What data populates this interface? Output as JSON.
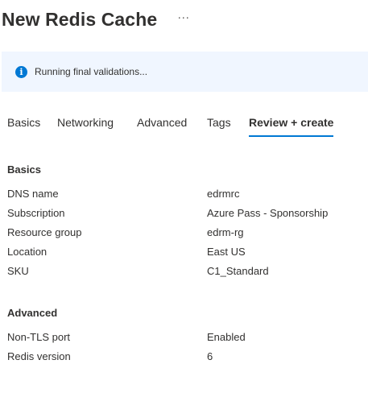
{
  "header": {
    "title": "New Redis Cache",
    "more_label": "···"
  },
  "notice": {
    "icon": "info-icon",
    "icon_glyph": "i",
    "text": "Running final validations..."
  },
  "tabs": [
    {
      "label": "Basics",
      "active": false
    },
    {
      "label": "Networking",
      "active": false
    },
    {
      "label": "Advanced",
      "active": false
    },
    {
      "label": "Tags",
      "active": false
    },
    {
      "label": "Review + create",
      "active": true
    }
  ],
  "sections": {
    "basics": {
      "title": "Basics",
      "rows": [
        {
          "label": "DNS name",
          "value": "edrmrc"
        },
        {
          "label": "Subscription",
          "value": "Azure Pass - Sponsorship"
        },
        {
          "label": "Resource group",
          "value": "edrm-rg"
        },
        {
          "label": "Location",
          "value": "East US"
        },
        {
          "label": "SKU",
          "value": "C1_Standard"
        }
      ]
    },
    "advanced": {
      "title": "Advanced",
      "rows": [
        {
          "label": "Non-TLS port",
          "value": "Enabled"
        },
        {
          "label": "Redis version",
          "value": "6"
        }
      ]
    }
  },
  "colors": {
    "accent": "#0078d4",
    "notice_background": "#f0f6ff",
    "text": "#323130"
  }
}
